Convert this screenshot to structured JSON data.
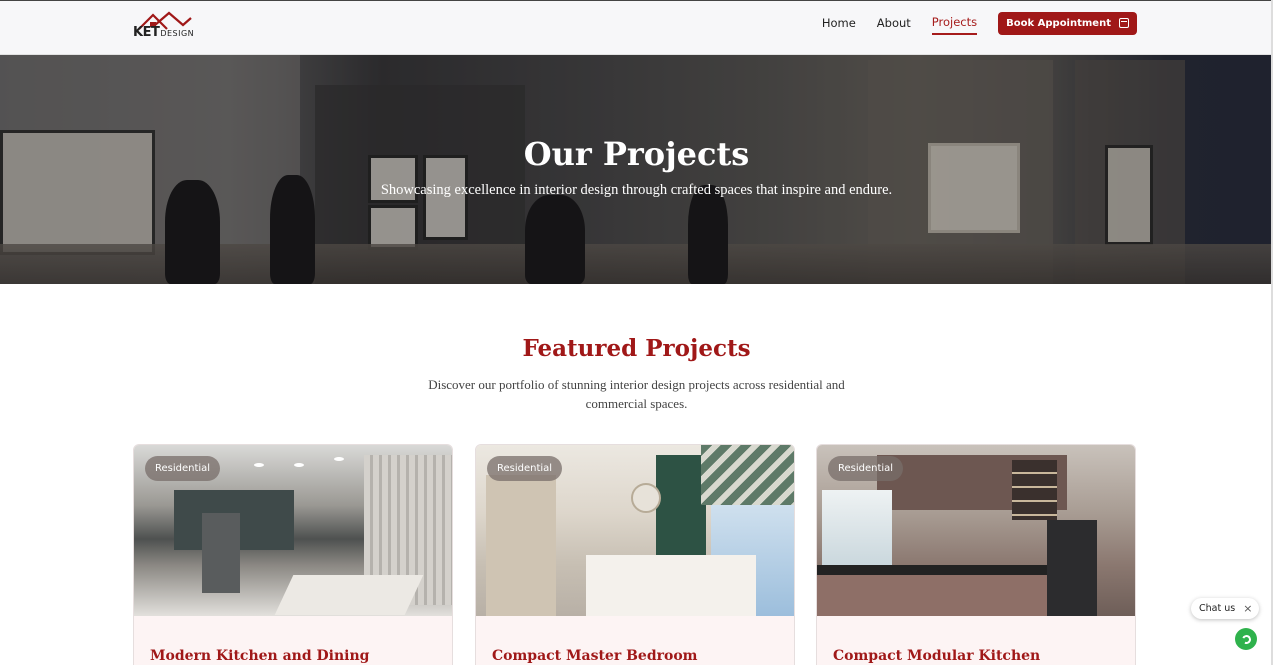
{
  "nav": {
    "logo_text": "KET",
    "logo_sub": "DESIGN",
    "links": [
      {
        "label": "Home",
        "active": false
      },
      {
        "label": "About",
        "active": false
      },
      {
        "label": "Projects",
        "active": true
      }
    ],
    "book_label": "Book Appointment",
    "book_icon": "calendar-icon"
  },
  "hero": {
    "title": "Our Projects",
    "subtitle": "Showcasing excellence in interior design through crafted spaces that inspire and endure."
  },
  "featured": {
    "title": "Featured Projects",
    "subtitle": "Discover our portfolio of stunning interior design projects across residential and commercial spaces."
  },
  "cards": [
    {
      "badge": "Residential",
      "title": "Modern Kitchen and Dining"
    },
    {
      "badge": "Residential",
      "title": "Compact Master Bedroom"
    },
    {
      "badge": "Residential",
      "title": "Compact Modular Kitchen"
    }
  ],
  "chat": {
    "label": "Chat us",
    "close": "×",
    "icon": "whatsapp-icon"
  },
  "colors": {
    "brand": "#a01818",
    "whatsapp": "#2fb24c"
  }
}
